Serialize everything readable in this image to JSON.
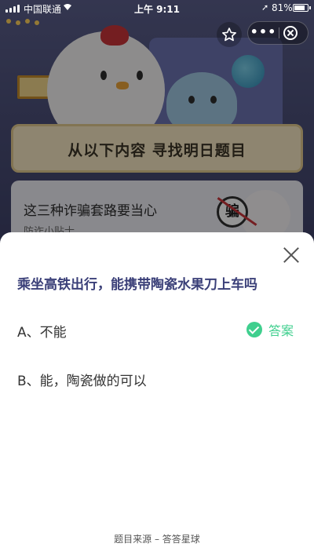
{
  "status_bar": {
    "carrier": "中国联通",
    "time": "上午 9:11",
    "battery_percent": "81%",
    "battery_level": 0.81
  },
  "background": {
    "banner_text": "从以下内容 寻找明日题目",
    "card_title": "这三种诈骗套路要当心",
    "card_subtitle": "防诈小贴士",
    "card_badge": "骗"
  },
  "top_controls": {
    "more_label": "•••"
  },
  "sheet": {
    "question": "乘坐高铁出行，能携带陶瓷水果刀上车吗",
    "options": [
      {
        "label": "A、不能",
        "correct": true
      },
      {
        "label": "B、能，陶瓷做的可以",
        "correct": false
      }
    ],
    "answer_label": "答案",
    "footer": "题目来源 – 答答星球",
    "accent_color": "#3fcf8e",
    "question_color": "#3a3f78"
  }
}
